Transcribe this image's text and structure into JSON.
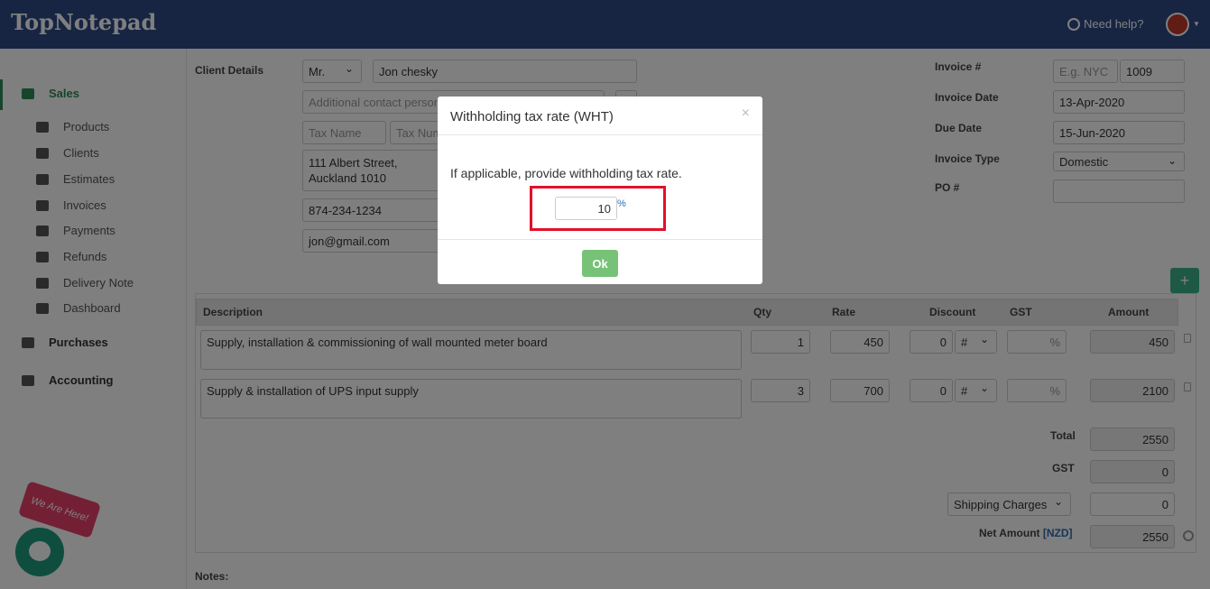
{
  "app": {
    "logo": "TopNotepad",
    "help": "Need help?"
  },
  "sidebar": {
    "items": [
      {
        "label": "Sales",
        "icon": "layers-icon"
      },
      {
        "label": "Products",
        "icon": "cubes-icon"
      },
      {
        "label": "Clients",
        "icon": "user-icon"
      },
      {
        "label": "Estimates",
        "icon": "file-icon"
      },
      {
        "label": "Invoices",
        "icon": "file-outline-icon"
      },
      {
        "label": "Payments",
        "icon": "credit-card-icon"
      },
      {
        "label": "Refunds",
        "icon": "exchange-icon"
      },
      {
        "label": "Delivery Note",
        "icon": "truck-icon"
      },
      {
        "label": "Dashboard",
        "icon": "dashboard-icon"
      },
      {
        "label": "Purchases",
        "icon": "minus-square-icon"
      },
      {
        "label": "Accounting",
        "icon": "bar-chart-icon"
      }
    ]
  },
  "client": {
    "label": "Client Details",
    "title": "Mr.",
    "name": "Jon chesky",
    "contact_placeholder": "Additional contact person",
    "tax_name_placeholder": "Tax Name",
    "tax_number_placeholder": "Tax Number",
    "address_line1": "111 Albert Street,",
    "address_line2": "Auckland 1010",
    "phone": "874-234-1234",
    "email": "jon@gmail.com"
  },
  "invoice": {
    "number_label": "Invoice #",
    "prefix_placeholder": "E.g. NYC",
    "number": "1009",
    "date_label": "Invoice Date",
    "date": "13-Apr-2020",
    "due_label": "Due Date",
    "due": "15-Jun-2020",
    "type_label": "Invoice Type",
    "type": "Domestic",
    "po_label": "PO #"
  },
  "table": {
    "headers": {
      "description": "Description",
      "qty": "Qty",
      "rate": "Rate",
      "discount": "Discount",
      "gst": "GST",
      "amount": "Amount"
    },
    "rows": [
      {
        "description": "Supply, installation & commissioning of wall mounted meter board",
        "qty": "1",
        "rate": "450",
        "discount": "0",
        "disc_type": "#",
        "gst_unit": "%",
        "amount": "450"
      },
      {
        "description": "Supply & installation of UPS input supply",
        "qty": "3",
        "rate": "700",
        "discount": "0",
        "disc_type": "#",
        "gst_unit": "%",
        "amount": "2100"
      }
    ]
  },
  "totals": {
    "total_label": "Total",
    "total": "2550",
    "gst_label": "GST",
    "gst": "0",
    "shipping_label": "Shipping Charges",
    "shipping": "0",
    "net_label": "Net Amount",
    "currency": "[NZD]",
    "net": "2550"
  },
  "notes_label": "Notes:",
  "modal": {
    "title": "Withholding tax rate (WHT)",
    "close": "×",
    "message": "If applicable, provide withholding tax rate.",
    "value": "10",
    "unit": "%",
    "ok": "Ok"
  },
  "chat": {
    "badge": "We Are Here!"
  }
}
